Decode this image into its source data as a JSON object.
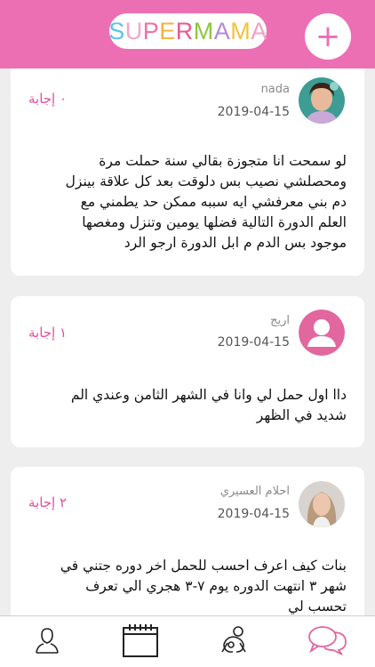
{
  "header": {
    "logo_text": "SUPERMAMA",
    "logo_letters": [
      "S",
      "U",
      "P",
      "E",
      "R",
      "M",
      "A",
      "M",
      "A"
    ],
    "logo_colors": [
      "#5bc3ea",
      "#f4a6c8",
      "#f26fa5",
      "#f4b43c",
      "#e85a8a",
      "#8dc63f",
      "#b18ad1",
      "#f3c13a",
      "#f4a0c4"
    ],
    "add_button_label": "+"
  },
  "colors": {
    "brand_pink": "#ec6fb3",
    "answer_pink": "#e04f9c"
  },
  "posts": [
    {
      "author": "nada",
      "date": "2019-04-15",
      "answers": "٠ إجابة",
      "avatar": "photo-avatar",
      "lines": [
        "لو سمحت انا متجوزة بقالي سنة حملت مرة",
        "ومحصلشي نصيب بس دلوقت بعد كل علاقة بينزل",
        "دم بني معرفشي ايه سببه ممكن حد يطمني مع",
        "العلم الدورة التالية فضلها يومين وتنزل ومغصها",
        "موجود بس الدم م ابل الدورة ارجو الرد"
      ]
    },
    {
      "author": "اريج",
      "date": "2019-04-15",
      "answers": "١ إجابة",
      "avatar": "default-user-icon",
      "lines": [
        "داا اول حمل لي وانا في الشهر الثامن وعندي الم",
        "شديد في الظهر"
      ]
    },
    {
      "author": "احلام العسيري",
      "date": "2019-04-15",
      "answers": "٢ إجابة",
      "avatar": "photo-avatar",
      "lines": [
        "بنات كيف اعرف احسب للحمل اخر دوره جتني في",
        "شهر ٣ انتهت الدوره يوم ٧-٣ هجري الي تعرف",
        "تحسب لي"
      ]
    }
  ],
  "tabbar": {
    "items": [
      "profile-icon",
      "calendar-icon",
      "pregnancy-icon",
      "chat-icon"
    ],
    "active": "chat-icon"
  }
}
